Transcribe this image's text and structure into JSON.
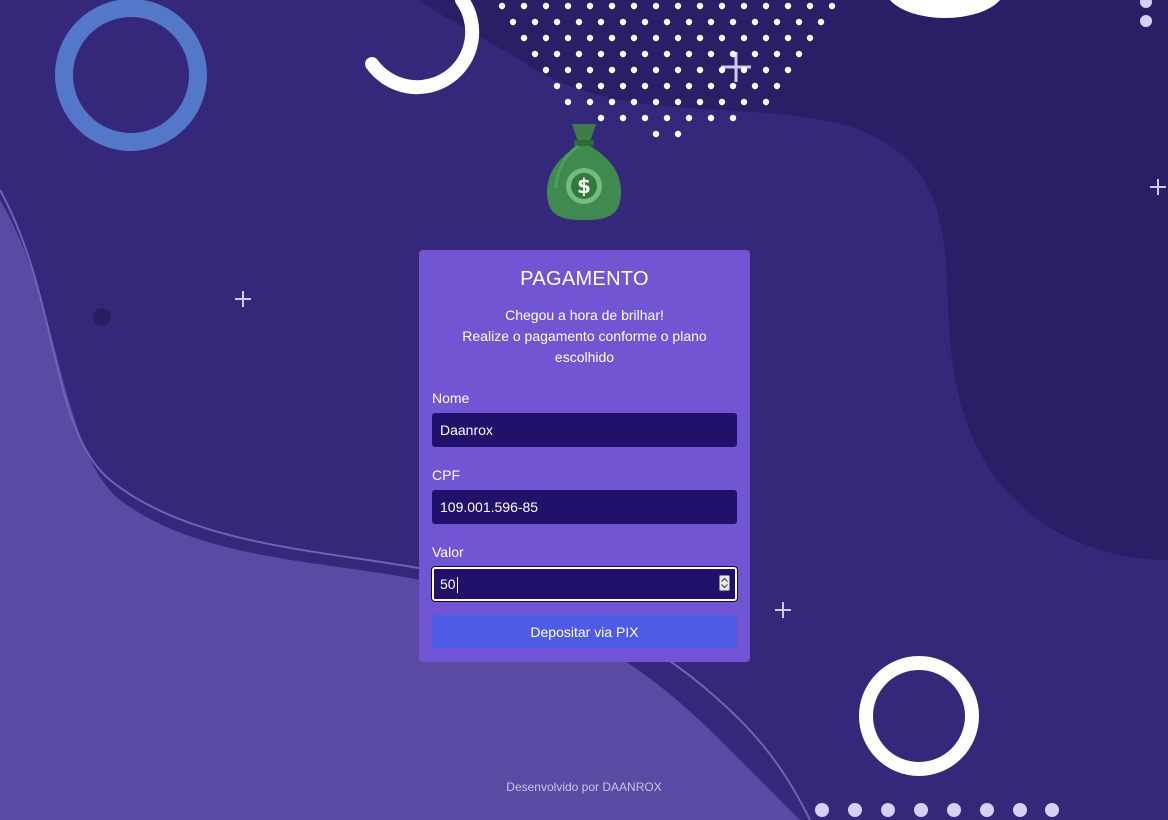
{
  "card": {
    "title": "PAGAMENTO",
    "subtitle_line1": "Chegou a hora de brilhar!",
    "subtitle_line2": "Realize o pagamento conforme o plano escolhido"
  },
  "form": {
    "nome": {
      "label": "Nome",
      "value": "Daanrox"
    },
    "cpf": {
      "label": "CPF",
      "value": "109.001.596-85"
    },
    "valor": {
      "label": "Valor",
      "value": "50"
    },
    "submit_label": "Depositar via PIX"
  },
  "footer": {
    "text": "Desenvolvido por DAANROX"
  },
  "icons": {
    "logo": "money-bag-icon",
    "dollar": "dollar-sign-icon"
  },
  "colors": {
    "background": "#35287a",
    "card": "#7255d2",
    "input": "#22116b",
    "button": "#4e5be6",
    "money_bag": "#3f8a4e"
  }
}
